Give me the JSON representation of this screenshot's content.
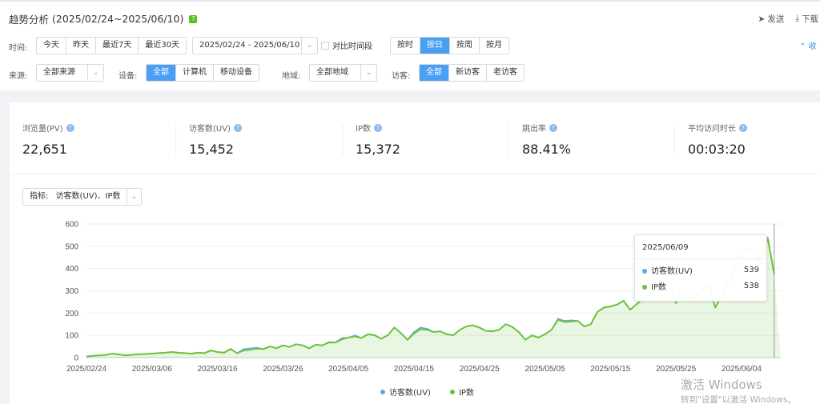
{
  "header": {
    "title": "趋势分析",
    "date_range": "(2025/02/24~2025/06/10)",
    "help": "?",
    "send": "发送",
    "download": "下载"
  },
  "filters": {
    "time_label": "时间:",
    "time_buttons": [
      "今天",
      "昨天",
      "最近7天",
      "最近30天"
    ],
    "date_range_value": "2025/02/24 - 2025/06/10",
    "compare_label": "对比时间段",
    "granularity": [
      "按时",
      "按日",
      "按周",
      "按月"
    ],
    "collapse": "收",
    "source_label": "来源:",
    "source_value": "全部来源",
    "device_label": "设备:",
    "devices": [
      "全部",
      "计算机",
      "移动设备"
    ],
    "region_label": "地域:",
    "region_value": "全部地域",
    "visitor_label": "访客:",
    "visitors": [
      "全部",
      "新访客",
      "老访客"
    ]
  },
  "metrics": [
    {
      "label": "浏览量(PV)",
      "value": "22,651"
    },
    {
      "label": "访客数(UV)",
      "value": "15,452"
    },
    {
      "label": "IP数",
      "value": "15,372"
    },
    {
      "label": "跳出率",
      "value": "88.41%"
    },
    {
      "label": "平均访问时长",
      "value": "00:03:20"
    }
  ],
  "indicator": {
    "label": "指标:",
    "value": "访客数(UV)、IP数"
  },
  "tooltip": {
    "date": "2025/06/09",
    "rows": [
      {
        "name": "访客数(UV)",
        "value": "539"
      },
      {
        "name": "IP数",
        "value": "538"
      }
    ]
  },
  "legend": [
    "访客数(UV)",
    "IP数"
  ],
  "watermark": {
    "line1": "激活 Windows",
    "line2": "转到\"设置\"以激活 Windows。"
  },
  "colors": {
    "uv": "#5aa8f0",
    "ip": "#6cc13b",
    "accent": "#4a9ff5"
  },
  "chart_data": {
    "type": "line",
    "x": [
      "2025/02/24",
      "2025/02/25",
      "2025/02/26",
      "2025/02/27",
      "2025/02/28",
      "2025/03/01",
      "2025/03/02",
      "2025/03/03",
      "2025/03/04",
      "2025/03/05",
      "2025/03/06",
      "2025/03/07",
      "2025/03/08",
      "2025/03/09",
      "2025/03/10",
      "2025/03/11",
      "2025/03/12",
      "2025/03/13",
      "2025/03/14",
      "2025/03/15",
      "2025/03/16",
      "2025/03/17",
      "2025/03/18",
      "2025/03/19",
      "2025/03/20",
      "2025/03/21",
      "2025/03/22",
      "2025/03/23",
      "2025/03/24",
      "2025/03/25",
      "2025/03/26",
      "2025/03/27",
      "2025/03/28",
      "2025/03/29",
      "2025/03/30",
      "2025/03/31",
      "2025/04/01",
      "2025/04/02",
      "2025/04/03",
      "2025/04/04",
      "2025/04/05",
      "2025/04/06",
      "2025/04/07",
      "2025/04/08",
      "2025/04/09",
      "2025/04/10",
      "2025/04/11",
      "2025/04/12",
      "2025/04/13",
      "2025/04/14",
      "2025/04/15",
      "2025/04/16",
      "2025/04/17",
      "2025/04/18",
      "2025/04/19",
      "2025/04/20",
      "2025/04/21",
      "2025/04/22",
      "2025/04/23",
      "2025/04/24",
      "2025/04/25",
      "2025/04/26",
      "2025/04/27",
      "2025/04/28",
      "2025/04/29",
      "2025/04/30",
      "2025/05/01",
      "2025/05/02",
      "2025/05/03",
      "2025/05/04",
      "2025/05/05",
      "2025/05/06",
      "2025/05/07",
      "2025/05/08",
      "2025/05/09",
      "2025/05/10",
      "2025/05/11",
      "2025/05/12",
      "2025/05/13",
      "2025/05/14",
      "2025/05/15",
      "2025/05/16",
      "2025/05/17",
      "2025/05/18",
      "2025/05/19",
      "2025/05/20",
      "2025/05/21",
      "2025/05/22",
      "2025/05/23",
      "2025/05/24",
      "2025/05/25",
      "2025/05/26",
      "2025/05/27",
      "2025/05/28",
      "2025/05/29",
      "2025/05/30",
      "2025/05/31",
      "2025/06/01",
      "2025/06/02",
      "2025/06/03",
      "2025/06/04",
      "2025/06/05",
      "2025/06/06",
      "2025/06/07",
      "2025/06/08",
      "2025/06/09",
      "2025/06/10"
    ],
    "series": [
      {
        "name": "访客数(UV)",
        "values": [
          5,
          8,
          10,
          12,
          18,
          14,
          10,
          13,
          15,
          16,
          18,
          20,
          22,
          25,
          22,
          20,
          18,
          22,
          20,
          32,
          25,
          22,
          40,
          20,
          38,
          42,
          45,
          38,
          50,
          42,
          55,
          48,
          60,
          55,
          42,
          58,
          55,
          70,
          68,
          88,
          90,
          100,
          88,
          105,
          100,
          85,
          100,
          135,
          110,
          80,
          115,
          135,
          130,
          115,
          118,
          105,
          100,
          125,
          140,
          145,
          135,
          120,
          118,
          125,
          150,
          138,
          115,
          80,
          100,
          90,
          105,
          125,
          175,
          165,
          168,
          165,
          140,
          150,
          205,
          225,
          230,
          238,
          255,
          215,
          240,
          265,
          285,
          310,
          330,
          340,
          245,
          310,
          260,
          280,
          300,
          330,
          225,
          280,
          340,
          390,
          480,
          490,
          470,
          420,
          539,
          375
        ],
        "color": "#5aa8f0"
      },
      {
        "name": "IP数",
        "values": [
          5,
          8,
          10,
          12,
          18,
          14,
          10,
          13,
          15,
          16,
          18,
          20,
          22,
          25,
          22,
          20,
          18,
          22,
          20,
          32,
          25,
          22,
          38,
          20,
          32,
          35,
          40,
          38,
          50,
          42,
          55,
          48,
          60,
          55,
          42,
          58,
          55,
          68,
          68,
          82,
          90,
          95,
          88,
          105,
          100,
          85,
          100,
          135,
          110,
          80,
          108,
          128,
          125,
          115,
          118,
          105,
          100,
          125,
          140,
          145,
          135,
          120,
          118,
          125,
          150,
          138,
          115,
          80,
          100,
          90,
          105,
          125,
          170,
          160,
          162,
          165,
          140,
          150,
          205,
          225,
          230,
          238,
          255,
          215,
          240,
          265,
          285,
          310,
          330,
          340,
          245,
          310,
          260,
          280,
          300,
          330,
          225,
          280,
          340,
          390,
          480,
          490,
          470,
          420,
          538,
          375
        ],
        "color": "#6cc13b"
      }
    ],
    "ylim": [
      0,
      600
    ],
    "yticks": [
      0,
      100,
      200,
      300,
      400,
      500,
      600
    ],
    "xticks": [
      "2025/02/24",
      "2025/03/06",
      "2025/03/16",
      "2025/03/26",
      "2025/04/05",
      "2025/04/15",
      "2025/04/25",
      "2025/05/05",
      "2025/05/15",
      "2025/05/25",
      "2025/06/04"
    ],
    "grid": true,
    "legend_position": "bottom"
  }
}
